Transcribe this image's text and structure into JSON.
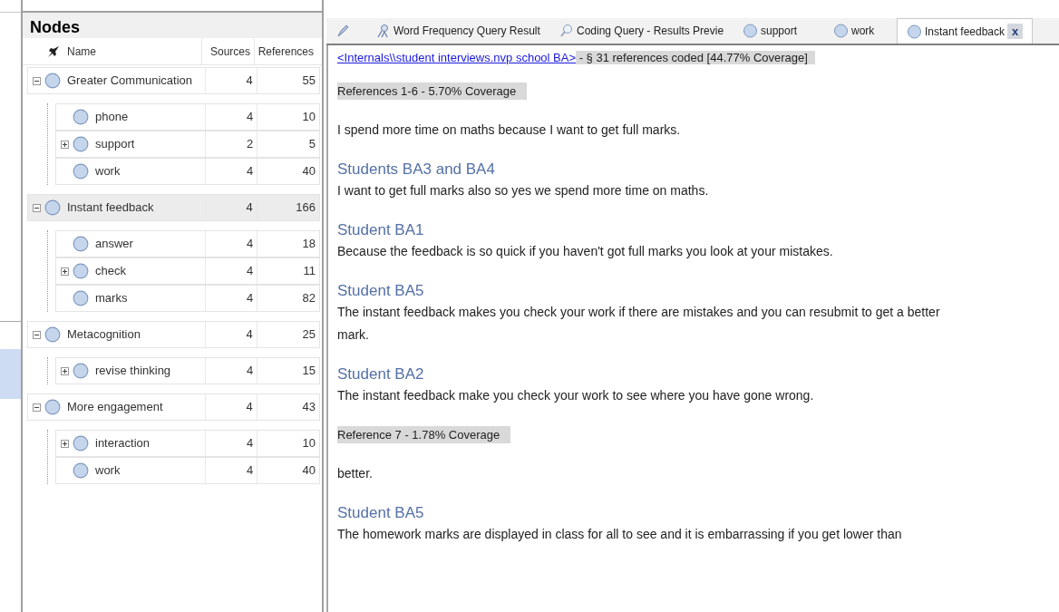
{
  "nodes_panel": {
    "title": "Nodes",
    "columns": [
      "Name",
      "Sources",
      "References"
    ],
    "rows": [
      {
        "name": "Greater Communication",
        "sources": "4",
        "references": "55",
        "expanded": true,
        "selected": false,
        "children": [
          {
            "name": "phone",
            "sources": "4",
            "references": "10",
            "selected": false
          },
          {
            "name": "support",
            "sources": "2",
            "references": "5",
            "expanded": false,
            "selected": false
          },
          {
            "name": "work",
            "sources": "4",
            "references": "40",
            "selected": false
          }
        ]
      },
      {
        "name": "Instant feedback",
        "sources": "4",
        "references": "166",
        "expanded": true,
        "selected": true,
        "children": [
          {
            "name": "answer",
            "sources": "4",
            "references": "18",
            "selected": false
          },
          {
            "name": "check",
            "sources": "4",
            "references": "11",
            "expanded": false,
            "selected": false
          },
          {
            "name": "marks",
            "sources": "4",
            "references": "82",
            "selected": false
          }
        ]
      },
      {
        "name": "Metacognition",
        "sources": "4",
        "references": "25",
        "expanded": true,
        "selected": false,
        "children": [
          {
            "name": "revise thinking",
            "sources": "4",
            "references": "15",
            "expanded": false,
            "selected": false
          }
        ]
      },
      {
        "name": "More engagement",
        "sources": "4",
        "references": "43",
        "expanded": true,
        "selected": false,
        "children": [
          {
            "name": "interaction",
            "sources": "4",
            "references": "10",
            "expanded": false,
            "selected": false
          },
          {
            "name": "work",
            "sources": "4",
            "references": "40",
            "selected": false
          }
        ]
      }
    ]
  },
  "tabs": [
    {
      "kind": "tool",
      "selected": false
    },
    {
      "kind": "query",
      "label": "Word Frequency Query Result",
      "selected": false
    },
    {
      "kind": "search",
      "label": "Coding Query - Results Previe",
      "selected": false
    },
    {
      "kind": "node",
      "label": "support",
      "selected": false
    },
    {
      "kind": "node",
      "label": "work",
      "selected": false
    },
    {
      "kind": "node",
      "label": "Instant feedback",
      "selected": true,
      "close": "x"
    }
  ],
  "content": [
    {
      "kind": "header",
      "link": "<Internals\\\\student interviews.nvp school BA>",
      "text": " - § 31 references coded  [44.77% Coverage]"
    },
    {
      "kind": "reference",
      "text": "References 1-6 - 5.70% Coverage"
    },
    {
      "kind": "text",
      "text": "I spend more time on maths because I want to get full marks."
    },
    {
      "kind": "speaker",
      "text": "Students BA3 and BA4"
    },
    {
      "kind": "text",
      "text": "I want to get full marks also so yes we spend more time on maths."
    },
    {
      "kind": "speaker",
      "text": "Student BA1"
    },
    {
      "kind": "text",
      "text": "Because the feedback is so quick if you haven't got full marks you look at your mistakes."
    },
    {
      "kind": "speaker",
      "text": "Student BA5"
    },
    {
      "kind": "text",
      "text": "The instant feedback makes you check your work if there are mistakes and you can resubmit to get a better mark."
    },
    {
      "kind": "speaker",
      "text": "Student BA2"
    },
    {
      "kind": "text",
      "text": "The instant feedback make you check your work to see where you have gone wrong."
    },
    {
      "kind": "reference",
      "text": "Reference 7 - 1.78% Coverage"
    },
    {
      "kind": "text",
      "text": "better."
    },
    {
      "kind": "speaker",
      "text": "Student BA5"
    },
    {
      "kind": "text",
      "text": "The homework marks are displayed in class for all to see and it is embarrassing if you get lower than"
    }
  ]
}
